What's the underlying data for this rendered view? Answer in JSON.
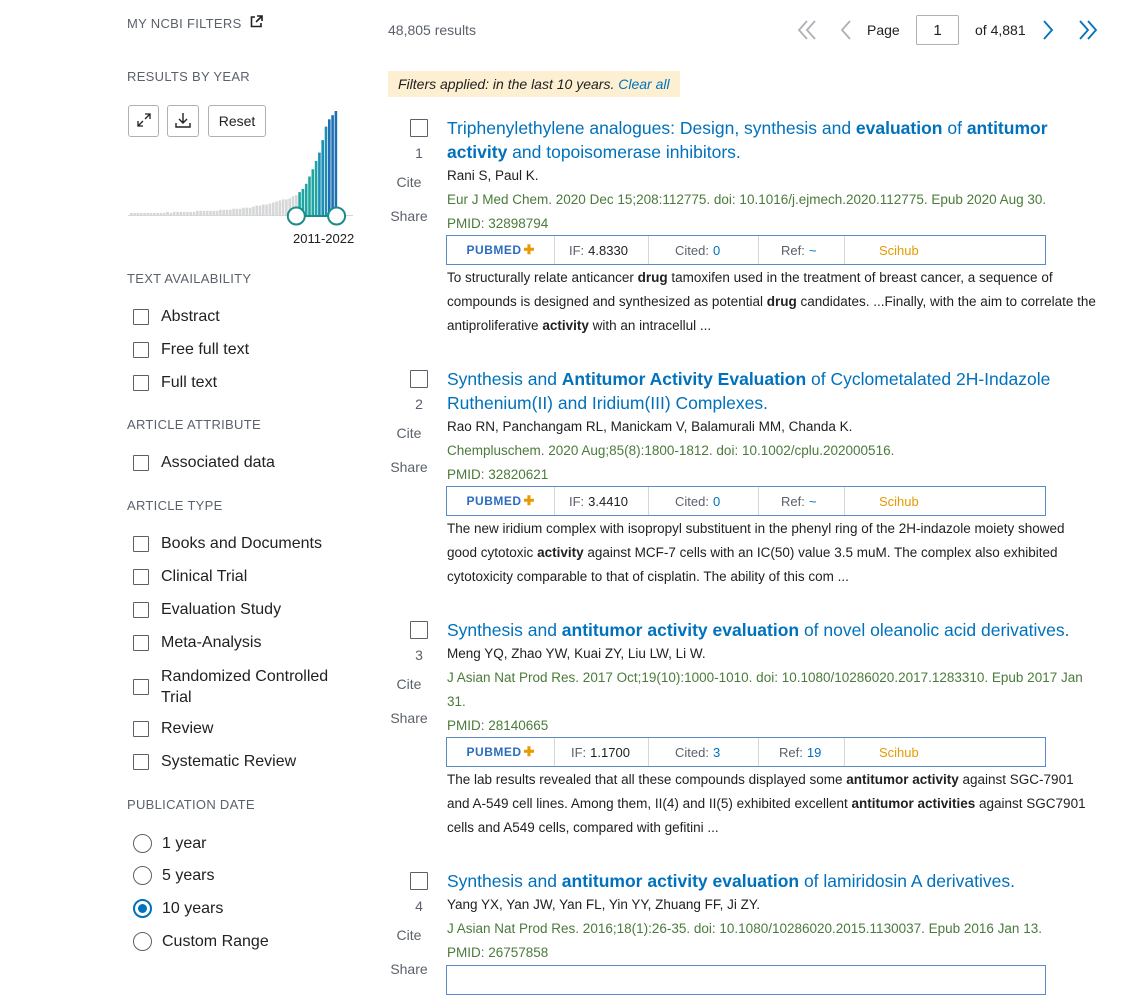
{
  "sidebar": {
    "my_ncbi_filters": "MY NCBI FILTERS",
    "results_by_year": "RESULTS BY YEAR",
    "reset_label": "Reset",
    "year_range_label": "2011-2022",
    "year_histogram": [
      2,
      2,
      2,
      2,
      2,
      2,
      2,
      2,
      2,
      2,
      2,
      3,
      2,
      3,
      3,
      3,
      3,
      3,
      3,
      3,
      4,
      4,
      4,
      4,
      4,
      4,
      4,
      5,
      5,
      5,
      5,
      6,
      6,
      6,
      7,
      7,
      7,
      8,
      9,
      9,
      10,
      10,
      11,
      12,
      13,
      14,
      15,
      15,
      16,
      18,
      19,
      22,
      25,
      30,
      37,
      44,
      52,
      60,
      72,
      85,
      92,
      96,
      100
    ],
    "text_availability": {
      "heading": "TEXT AVAILABILITY",
      "options": [
        "Abstract",
        "Free full text",
        "Full text"
      ]
    },
    "article_attribute": {
      "heading": "ARTICLE ATTRIBUTE",
      "options": [
        "Associated data"
      ]
    },
    "article_type": {
      "heading": "ARTICLE TYPE",
      "options": [
        "Books and Documents",
        "Clinical Trial",
        "Evaluation Study",
        "Meta-Analysis",
        "Randomized Controlled",
        "Trial",
        "Review",
        "Systematic Review"
      ]
    },
    "publication_date": {
      "heading": "PUBLICATION DATE",
      "options": [
        "1 year",
        "5 years",
        "10 years",
        "Custom Range"
      ],
      "selected": "10 years"
    }
  },
  "topbar": {
    "results_count": "48,805 results",
    "page_label": "Page",
    "page_value": "1",
    "of_pages": "of 4,881"
  },
  "filters_banner": {
    "text": "Filters applied: in the last 10 years.",
    "clear_all": "Clear all"
  },
  "labels": {
    "cite": "Cite",
    "share": "Share",
    "pubmed": "PUBMED",
    "if": "IF:",
    "cited": "Cited:",
    "ref": "Ref:",
    "scihub": "Scihub"
  },
  "results": [
    {
      "num": "1",
      "title_html": "Triphenylethylene analogues: Design, synthesis and <b>evaluation</b> of <b>antitumor activity</b> and topoisomerase inhibitors.",
      "authors": "Rani S, Paul K.",
      "journal": "Eur J Med Chem. 2020 Dec 15;208:112775. doi: 10.1016/j.ejmech.2020.112775. Epub 2020 Aug 30.",
      "pmid": "PMID: 32898794",
      "if": "4.8330",
      "cited": "0",
      "ref": "~",
      "snippet_html": "To structurally relate anticancer <b>drug</b> tamoxifen used in the treatment of breast cancer, a sequence of compounds is designed and synthesized as potential <b>drug</b> candidates. ...Finally, with the aim to correlate the antiproliferative <b>activity</b> with an intracellul ..."
    },
    {
      "num": "2",
      "title_html": "Synthesis and <b>Antitumor Activity Evaluation</b> of Cyclometalated 2H-Indazole Ruthenium(II) and Iridium(III) Complexes.",
      "authors": "Rao RN, Panchangam RL, Manickam V, Balamurali MM, Chanda K.",
      "journal": "Chempluschem. 2020 Aug;85(8):1800-1812. doi: 10.1002/cplu.202000516.",
      "pmid": "PMID: 32820621",
      "if": "3.4410",
      "cited": "0",
      "ref": "~",
      "snippet_html": "The new iridium complex with isopropyl substituent in the phenyl ring of the 2H-indazole moiety showed good cytotoxic <b>activity</b> against MCF-7 cells with an IC(50) value 3.5 muM. The complex also exhibited cytotoxicity comparable to that of cisplatin. The ability of this com ..."
    },
    {
      "num": "3",
      "title_html": "Synthesis and <b>antitumor activity evaluation</b> of novel oleanolic acid derivatives.",
      "authors": "Meng YQ, Zhao YW, Kuai ZY, Liu LW, Li W.",
      "journal": "J Asian Nat Prod Res. 2017 Oct;19(10):1000-1010. doi: 10.1080/10286020.2017.1283310. Epub 2017 Jan 31.",
      "pmid": "PMID: 28140665",
      "if": "1.1700",
      "cited": "3",
      "ref": "19",
      "snippet_html": "The lab results revealed that all these compounds displayed some <b>antitumor activity</b> against SGC-7901 and A-549 cell lines. Among them, II(4) and II(5) exhibited excellent <b>antitumor activities</b> against SGC7901 cells and A549 cells, compared with gefitini ..."
    },
    {
      "num": "4",
      "title_html": "Synthesis and <b>antitumor activity evaluation</b> of lamiridosin A derivatives.",
      "authors": "Yang YX, Yan JW, Yan FL, Yin YY, Zhuang FF, Ji ZY.",
      "journal": "J Asian Nat Prod Res. 2016;18(1):26-35. doi: 10.1080/10286020.2015.1130037. Epub 2016 Jan 13.",
      "pmid": "PMID: 26757858"
    }
  ]
}
